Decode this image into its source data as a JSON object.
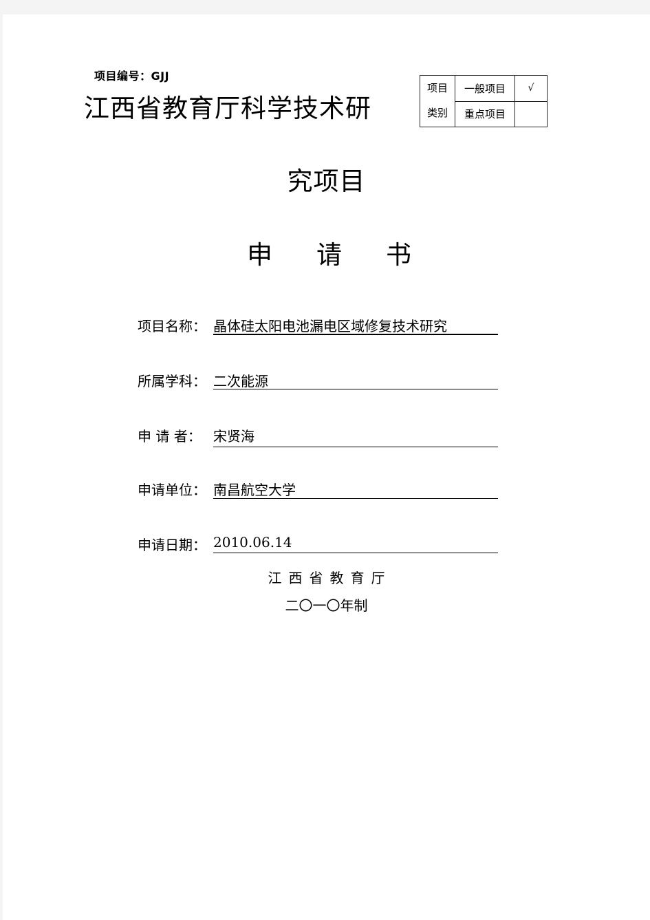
{
  "document": {
    "project_number_label": "项目编号：GJJ",
    "title_line1": "江西省教育厅科学技术研",
    "title_line2": "究项目",
    "title_line3": [
      "申",
      "请",
      "书"
    ]
  },
  "category_table": {
    "header": [
      "项目",
      "类别"
    ],
    "rows": [
      {
        "type": "一般项目",
        "mark": "√"
      },
      {
        "type": "重点项目",
        "mark": ""
      }
    ]
  },
  "fields": [
    {
      "label": "项目名称：",
      "value": "晶体硅太阳电池漏电区域修复技术研究"
    },
    {
      "label": "所属学科：",
      "value": "二次能源"
    },
    {
      "label": "申 请 者：",
      "value": "宋贤海"
    },
    {
      "label": "申请单位：",
      "value": "南昌航空大学"
    },
    {
      "label": "申请日期：",
      "value": "2010.06.14"
    }
  ],
  "footer": {
    "issuer": "江西省教育厅",
    "made": "二〇一〇年制"
  }
}
